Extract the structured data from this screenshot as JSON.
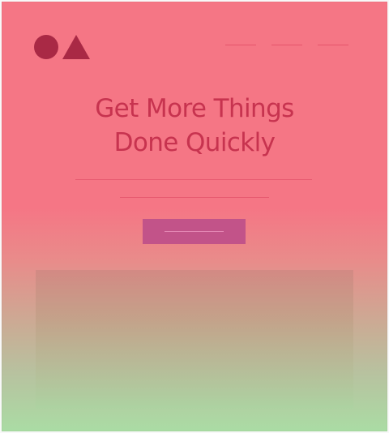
{
  "hero": {
    "title_line_1": "Get More Things",
    "title_line_2": "Done Quickly"
  },
  "logo": {
    "circle_icon": "circle-icon",
    "triangle_icon": "triangle-icon",
    "color": "#a92945"
  },
  "colors": {
    "top_background": "#f57685",
    "bottom_background": "#aadca4",
    "title": "#c7334f",
    "button": "#c25389"
  }
}
